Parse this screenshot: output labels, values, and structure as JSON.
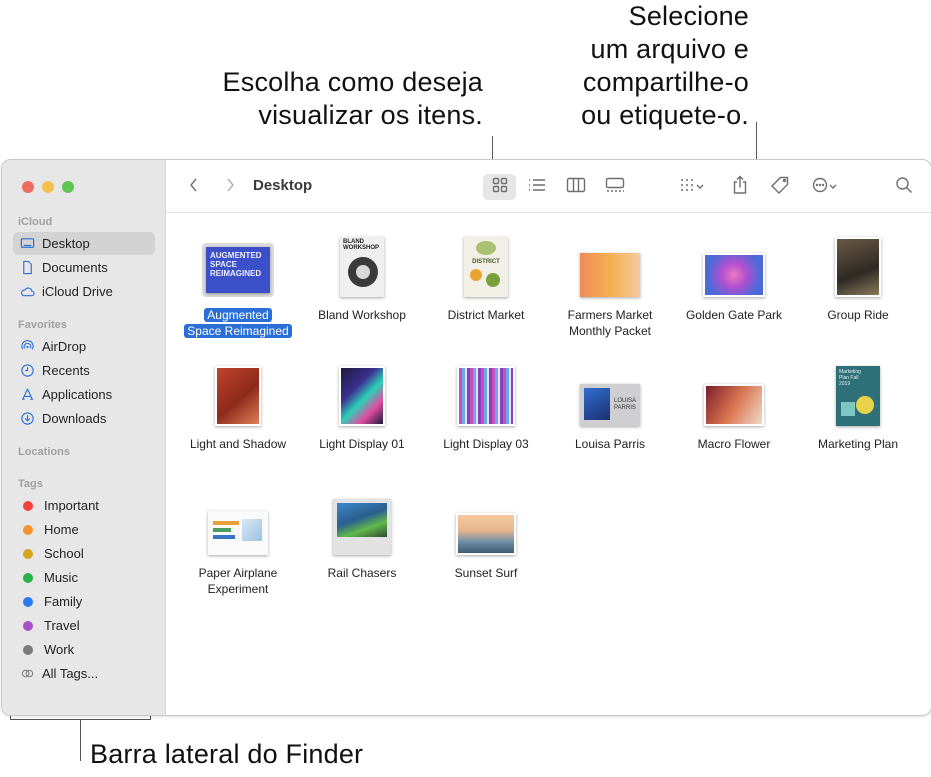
{
  "callouts": {
    "views": [
      "Escolha como deseja",
      "visualizar os itens."
    ],
    "share": [
      "Selecione",
      "um arquivo e",
      "compartilhe-o",
      "ou etiquete-o."
    ],
    "sidebar": "Barra lateral do Finder"
  },
  "window": {
    "title": "Desktop"
  },
  "sidebar": {
    "icloud_header": "iCloud",
    "icloud_items": [
      {
        "label": "Desktop",
        "icon": "desktop-icon"
      },
      {
        "label": "Documents",
        "icon": "document-icon"
      },
      {
        "label": "iCloud Drive",
        "icon": "cloud-icon"
      }
    ],
    "favorites_header": "Favorites",
    "favorite_items": [
      {
        "label": "AirDrop",
        "icon": "airdrop-icon"
      },
      {
        "label": "Recents",
        "icon": "clock-icon"
      },
      {
        "label": "Applications",
        "icon": "applications-icon"
      },
      {
        "label": "Downloads",
        "icon": "download-icon"
      }
    ],
    "locations_header": "Locations",
    "tags_header": "Tags",
    "tags": [
      {
        "label": "Important",
        "color": "#f0443a"
      },
      {
        "label": "Home",
        "color": "#f5942f"
      },
      {
        "label": "School",
        "color": "#d6a51b"
      },
      {
        "label": "Music",
        "color": "#29b246"
      },
      {
        "label": "Family",
        "color": "#2a7bf0"
      },
      {
        "label": "Travel",
        "color": "#a652c8"
      },
      {
        "label": "Work",
        "color": "#7b7b7b"
      }
    ],
    "all_tags": "All Tags..."
  },
  "files": [
    {
      "name": "Augmented Space Reimagined",
      "lines": [
        "Augmented",
        "Space Reimagined"
      ],
      "selected": true
    },
    {
      "name": "Bland Workshop",
      "lines": [
        "Bland Workshop"
      ]
    },
    {
      "name": "District Market",
      "lines": [
        "District Market"
      ]
    },
    {
      "name": "Farmers Market Monthly Packet",
      "lines": [
        "Farmers Market",
        "Monthly Packet"
      ]
    },
    {
      "name": "Golden Gate Park",
      "lines": [
        "Golden Gate Park"
      ]
    },
    {
      "name": "Group Ride",
      "lines": [
        "Group Ride"
      ]
    },
    {
      "name": "Light and Shadow",
      "lines": [
        "Light and Shadow"
      ]
    },
    {
      "name": "Light Display 01",
      "lines": [
        "Light Display 01"
      ]
    },
    {
      "name": "Light Display 03",
      "lines": [
        "Light Display 03"
      ]
    },
    {
      "name": "Louisa Parris",
      "lines": [
        "Louisa Parris"
      ]
    },
    {
      "name": "Macro Flower",
      "lines": [
        "Macro Flower"
      ]
    },
    {
      "name": "Marketing Plan",
      "lines": [
        "Marketing Plan"
      ]
    },
    {
      "name": "Paper Airplane Experiment",
      "lines": [
        "Paper Airplane",
        "Experiment"
      ]
    },
    {
      "name": "Rail Chasers",
      "lines": [
        "Rail Chasers"
      ]
    },
    {
      "name": "Sunset Surf",
      "lines": [
        "Sunset Surf"
      ]
    }
  ],
  "thumb_text": {
    "augmented": [
      "AUGMENTED",
      "SPACE",
      "REIMAGINED"
    ],
    "bland": [
      "BLAND",
      "WORKSHOP"
    ],
    "district": "DISTRICT",
    "louisa": [
      "LOUISA",
      "PARRIS"
    ],
    "marketing": "Marketing Plan Fall 2019"
  }
}
